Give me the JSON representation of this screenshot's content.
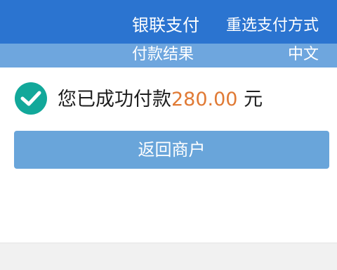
{
  "header": {
    "title": "银联支付",
    "reselect_label": "重选支付方式"
  },
  "subheader": {
    "title": "付款结果",
    "language_label": "中文"
  },
  "result": {
    "icon": "check-circle-icon",
    "message": "您已成功付款",
    "amount": "280.00",
    "currency": " 元"
  },
  "actions": {
    "return_label": "返回商户"
  },
  "colors": {
    "header_bg": "#2b74d0",
    "subheader_bg": "#6ea6de",
    "check_icon": "#12a89a",
    "amount": "#e07a35",
    "button_bg": "#69a5da"
  }
}
